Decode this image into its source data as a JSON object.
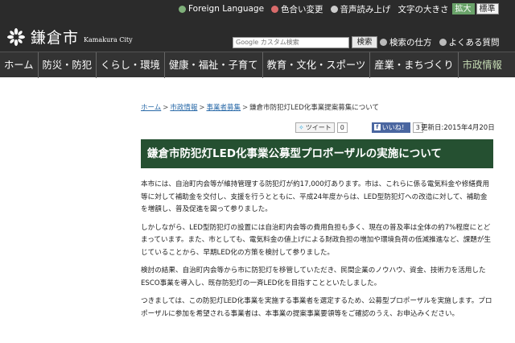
{
  "header": {
    "site_name": "鎌倉市",
    "site_name_en": "Kamakura City",
    "utility": {
      "foreign_language": "Foreign Language",
      "color_change": "色合い変更",
      "read_aloud": "音声読み上げ",
      "font_size_label": "文字の大きさ",
      "font_large": "拡大",
      "font_normal": "標準",
      "search_method": "検索の仕方",
      "faq": "よくある質問"
    },
    "search": {
      "placeholder": "Google カスタム検索",
      "button_label": "検索"
    }
  },
  "nav": {
    "items": [
      {
        "label": "ホーム"
      },
      {
        "label": "防災・防犯"
      },
      {
        "label": "くらし・環境"
      },
      {
        "label": "健康・福祉・子育て"
      },
      {
        "label": "教育・文化・スポーツ"
      },
      {
        "label": "産業・まちづくり"
      },
      {
        "label": "市政情報"
      }
    ]
  },
  "breadcrumb": {
    "items": [
      "ホーム",
      "市政情報",
      "事業者募集"
    ],
    "current": "鎌倉市防犯灯LED化事業提案募集について"
  },
  "social": {
    "tweet_label": "ツイート",
    "tweet_count": "0",
    "like_label": "いいね！",
    "like_count": "3"
  },
  "updated": "更新日:2015年4月20日",
  "article": {
    "title": "鎌倉市防犯灯LED化事業公募型プロポーザルの実施について",
    "paragraphs": [
      "本市には、自治町内会等が維持管理する防犯灯が約17,000灯あります。市は、これらに係る電気料金や修繕費用等に対して補助金を交付し、支援を行うとともに、平成24年度からは、LED型防犯灯への改造に対して、補助金を増額し、普及促進を図って参りました。",
      "しかしながら、LED型防犯灯の設置には自治町内会等の費用負担も多く、現在の普及率は全体の約7%程度にとどまっています。また、市としても、電気料金の値上げによる財政負担の増加や環境負荷の低減推進など、課題が生じていることから、早期LED化の方策を検討して参りました。",
      "検討の結果、自治町内会等から市に防犯灯を移管していただき、民間企業のノウハウ、資金、技術力を活用したESCO事業を導入し、既存防犯灯の一斉LED化を目指すことといたしました。",
      "つきましては、この防犯灯LED化事業を実施する事業者を選定するため、公募型プロポーザルを実施します。プロポーザルに参加を希望される事業者は、本事業の提案事業要領等をご確認のうえ、お申込みください。"
    ]
  },
  "colors": {
    "header_bg": "#2b2b2b",
    "title_bar_bg": "#255031",
    "link": "#2a6aa8",
    "font_large_bg": "#6aa36a"
  }
}
